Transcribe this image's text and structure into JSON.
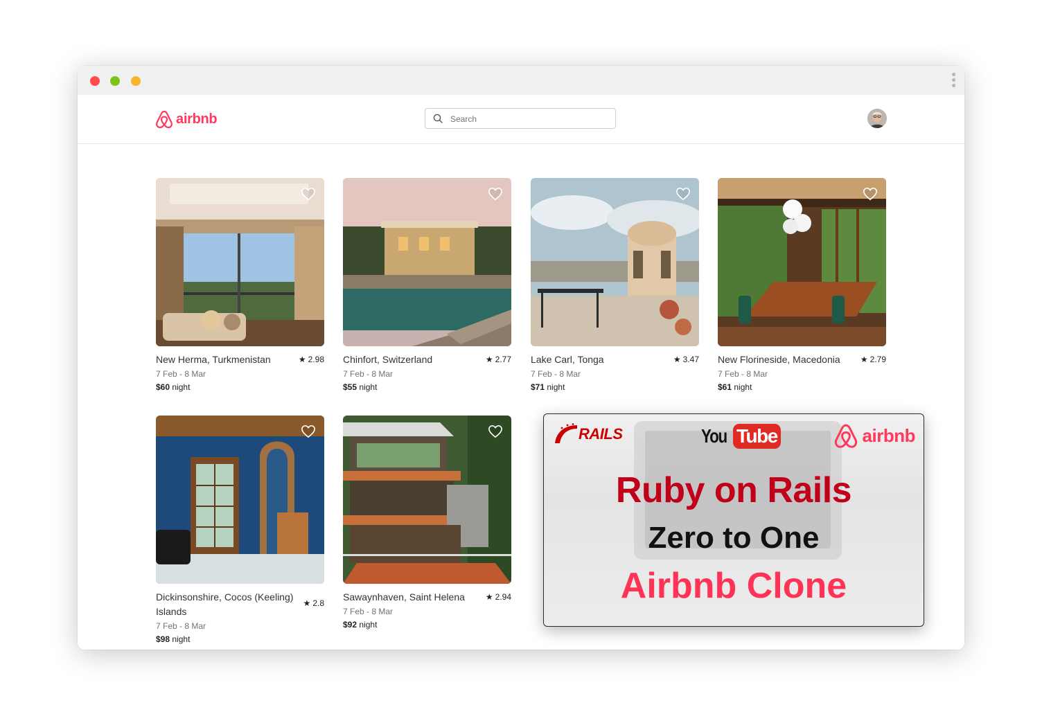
{
  "header": {
    "logo_text": "airbnb",
    "search_placeholder": "Search",
    "avatar": "user-avatar"
  },
  "listings": [
    {
      "location": "New Herma, Turkmenistan",
      "rating": "2.98",
      "dates": "7 Feb - 8 Mar",
      "price": "$60",
      "unit": "night"
    },
    {
      "location": "Chinfort, Switzerland",
      "rating": "2.77",
      "dates": "7 Feb - 8 Mar",
      "price": "$55",
      "unit": "night"
    },
    {
      "location": "Lake Carl, Tonga",
      "rating": "3.47",
      "dates": "7 Feb - 8 Mar",
      "price": "$71",
      "unit": "night"
    },
    {
      "location": "New Florineside, Macedonia",
      "rating": "2.79",
      "dates": "7 Feb - 8 Mar",
      "price": "$61",
      "unit": "night"
    },
    {
      "location": "Dickinsonshire, Cocos (Keeling) Islands",
      "rating": "2.8",
      "dates": "7 Feb - 8 Mar",
      "price": "$98",
      "unit": "night"
    },
    {
      "location": "Sawaynhaven, Saint Helena",
      "rating": "2.94",
      "dates": "7 Feb - 8 Mar",
      "price": "$92",
      "unit": "night"
    }
  ],
  "promo": {
    "rails_logo": "RAILS",
    "youtube_you": "You",
    "youtube_tube": "Tube",
    "airbnb_logo": "airbnb",
    "line1": "Ruby on Rails",
    "line2": "Zero to One",
    "line3": "Airbnb Clone"
  },
  "colors": {
    "brand": "#ff385c",
    "rails_red": "#cc0000",
    "youtube_red": "#e02a24"
  }
}
